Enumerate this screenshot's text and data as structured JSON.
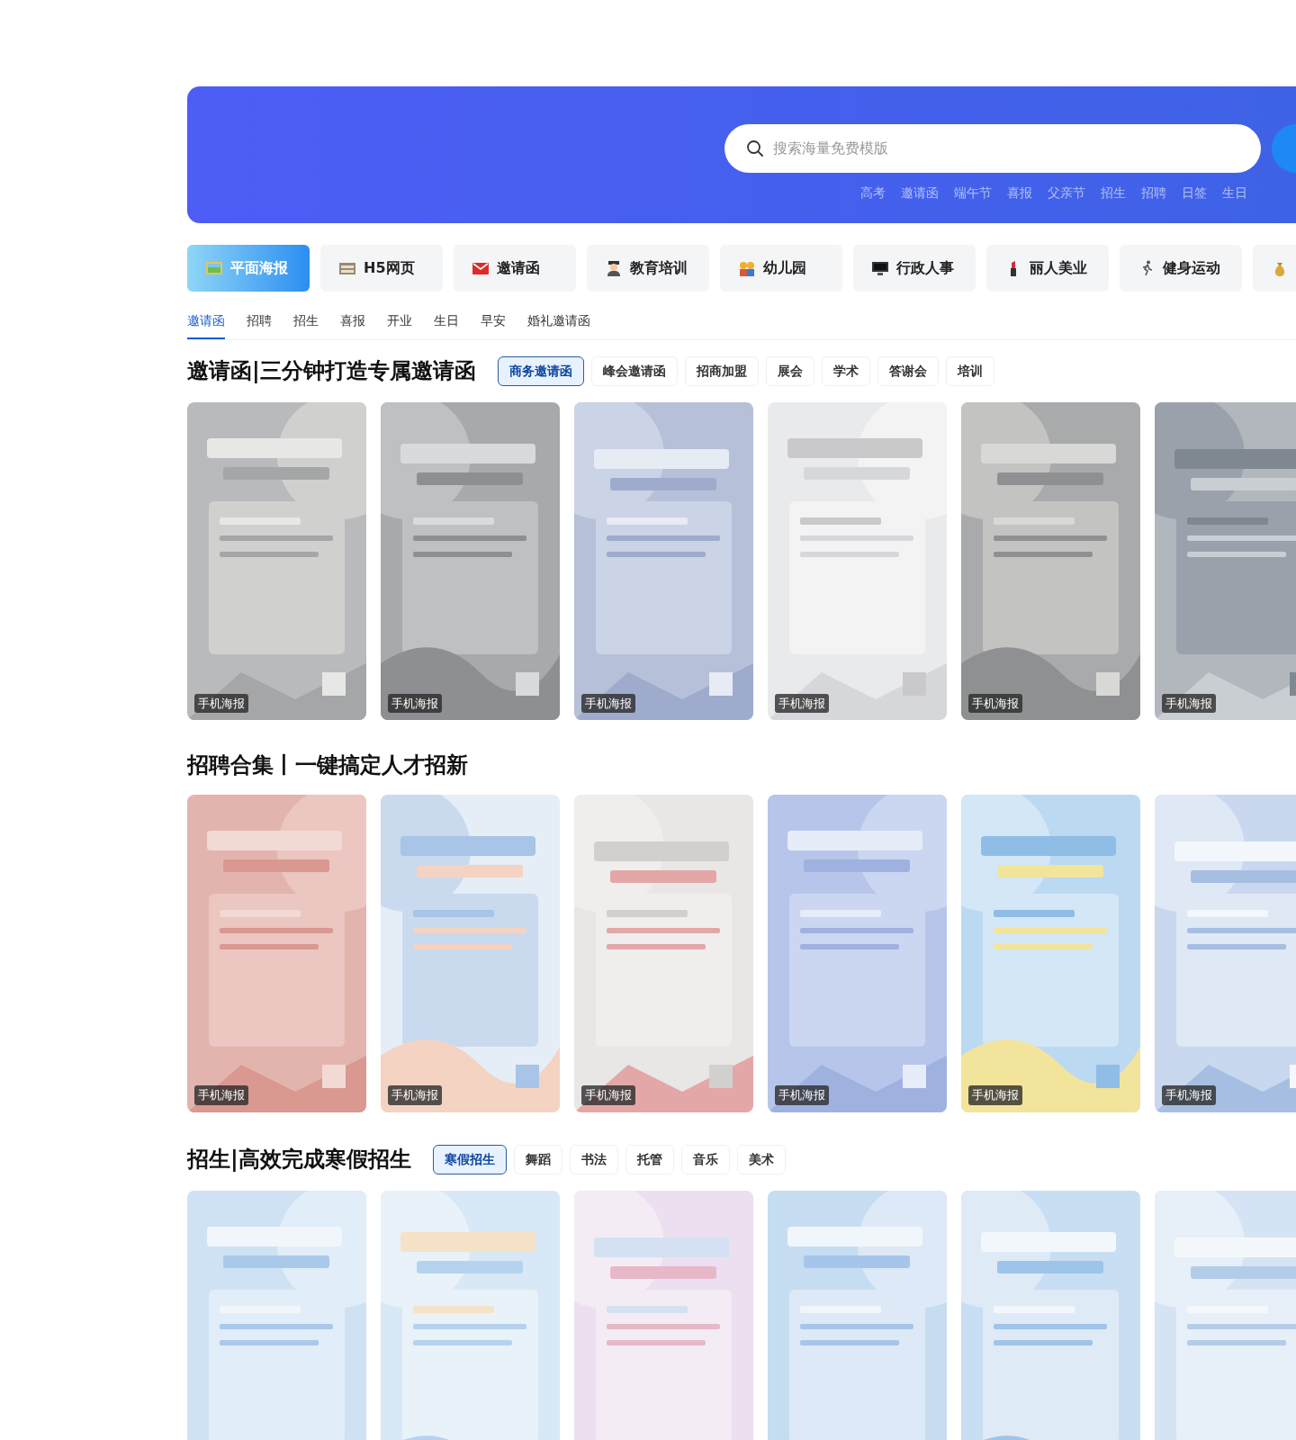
{
  "banner": {
    "search": {
      "placeholder": "搜索海量免费模版"
    },
    "hot_keywords": [
      "高考",
      "邀请函",
      "端午节",
      "喜报",
      "父亲节",
      "招生",
      "招聘",
      "日签",
      "生日"
    ]
  },
  "categories": [
    {
      "label": "平面海报",
      "selected": true
    },
    {
      "label": "H5网页",
      "selected": false
    },
    {
      "label": "邀请函",
      "selected": false
    },
    {
      "label": "教育培训",
      "selected": false
    },
    {
      "label": "幼儿园",
      "selected": false
    },
    {
      "label": "行政人事",
      "selected": false
    },
    {
      "label": "丽人美业",
      "selected": false
    },
    {
      "label": "健身运动",
      "selected": false
    },
    {
      "selected": false
    }
  ],
  "subtabs": [
    {
      "label": "邀请函",
      "selected": true
    },
    {
      "label": "招聘",
      "selected": false
    },
    {
      "label": "招生",
      "selected": false
    },
    {
      "label": "喜报",
      "selected": false
    },
    {
      "label": "开业",
      "selected": false
    },
    {
      "label": "生日",
      "selected": false
    },
    {
      "label": "早安",
      "selected": false
    },
    {
      "label": "婚礼邀请函",
      "selected": false
    }
  ],
  "sections": [
    {
      "title": "邀请函|三分钟打造专属邀请函",
      "filters": [
        {
          "label": "商务邀请函",
          "selected": true
        },
        {
          "label": "峰会邀请函",
          "selected": false
        },
        {
          "label": "招商加盟",
          "selected": false
        },
        {
          "label": "展会",
          "selected": false
        },
        {
          "label": "学术",
          "selected": false
        },
        {
          "label": "答谢会",
          "selected": false
        },
        {
          "label": "培训",
          "selected": false
        }
      ],
      "cards": [
        {
          "kind": "picture",
          "badge": "手机海报"
        },
        {
          "kind": "picture",
          "badge": "手机海报"
        },
        {
          "kind": "picture",
          "badge": "手机海报"
        },
        {
          "kind": "picture",
          "badge": "手机海报"
        },
        {
          "kind": "picture",
          "badge": "手机海报"
        },
        {
          "kind": "picture",
          "badge": "手机海报"
        }
      ]
    },
    {
      "title": "招聘合集丨一键搞定人才招新",
      "cards": [
        {
          "kind": "picture",
          "badge": "手机海报"
        },
        {
          "kind": "picture",
          "badge": "手机海报"
        },
        {
          "kind": "picture",
          "badge": "手机海报"
        },
        {
          "kind": "picture",
          "badge": "手机海报"
        },
        {
          "kind": "picture",
          "badge": "手机海报"
        },
        {
          "kind": "picture",
          "badge": "手机海报"
        }
      ]
    },
    {
      "title": "招生|高效完成寒假招生",
      "filters": [
        {
          "label": "寒假招生",
          "selected": true
        },
        {
          "label": "舞蹈",
          "selected": false
        },
        {
          "label": "书法",
          "selected": false
        },
        {
          "label": "托管",
          "selected": false
        },
        {
          "label": "音乐",
          "selected": false
        },
        {
          "label": "美术",
          "selected": false
        }
      ],
      "cards": [
        {
          "kind": "picture"
        },
        {
          "kind": "picture"
        },
        {
          "kind": "picture"
        },
        {
          "kind": "picture"
        },
        {
          "kind": "picture"
        },
        {
          "kind": "picture"
        }
      ]
    }
  ]
}
